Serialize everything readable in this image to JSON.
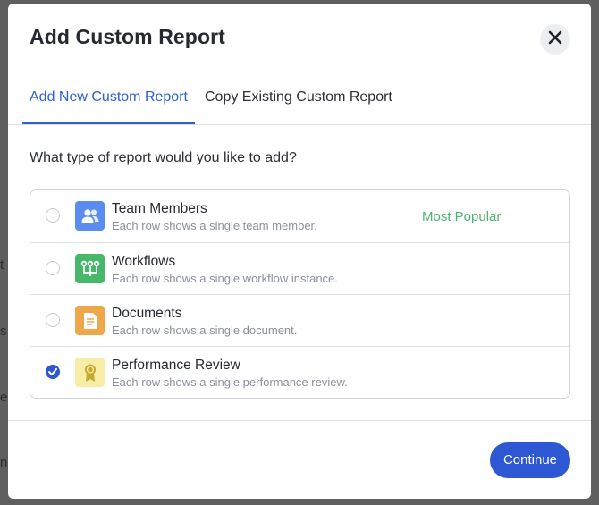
{
  "background": {
    "glyphs": [
      "t",
      "s",
      "e",
      "n"
    ]
  },
  "modal": {
    "title": "Add Custom Report",
    "close_icon": "close-icon"
  },
  "tabs": [
    {
      "label": "Add New Custom Report",
      "active": true
    },
    {
      "label": "Copy Existing Custom Report",
      "active": false
    }
  ],
  "question": "What type of report would you like to add?",
  "options": [
    {
      "title": "Team Members",
      "description": "Each row shows a single team member.",
      "icon": "team-members-icon",
      "icon_color": "#5b8def",
      "badge": "Most Popular",
      "selected": false
    },
    {
      "title": "Workflows",
      "description": "Each row shows a single workflow instance.",
      "icon": "workflow-icon",
      "icon_color": "#47b86a",
      "badge": "",
      "selected": false
    },
    {
      "title": "Documents",
      "description": "Each row shows a single document.",
      "icon": "document-icon",
      "icon_color": "#eea74a",
      "badge": "",
      "selected": false
    },
    {
      "title": "Performance Review",
      "description": "Each row shows a single performance review.",
      "icon": "award-ribbon-icon",
      "icon_color": "#f8eda6",
      "badge": "",
      "selected": true
    }
  ],
  "footer": {
    "continue_label": "Continue"
  },
  "colors": {
    "accent": "#2d57d3",
    "badge_green": "#4db36f"
  }
}
